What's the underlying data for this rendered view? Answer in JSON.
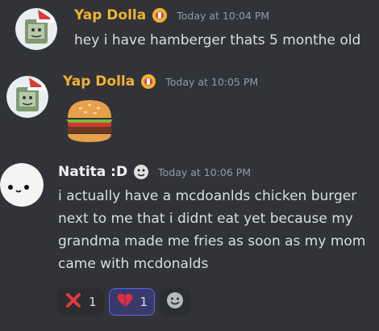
{
  "messages": [
    {
      "username": "Yap Dolla",
      "timestamp": "Today at 10:04 PM",
      "text": "hey i have hamberger thats 5 monthe old",
      "name_color": "#f0b232"
    },
    {
      "username": "Yap Dolla",
      "timestamp": "Today at 10:05 PM",
      "emoji": "burger",
      "name_color": "#f0b232"
    },
    {
      "username": "Natita :D",
      "timestamp": "Today at 10:06 PM",
      "lines": [
        "i actually have a mcdoanlds chicken burger",
        "next to me that i didnt eat yet because my",
        "grandma made me fries as soon as my mom",
        "came with mcdonalds"
      ],
      "name_color": "#f2f3f5",
      "reactions": [
        {
          "icon": "cross-mark-icon",
          "count": "1",
          "active": false
        },
        {
          "icon": "broken-heart-icon",
          "count": "1",
          "active": true
        }
      ],
      "add_reaction_icon": "smiley-icon"
    }
  ]
}
